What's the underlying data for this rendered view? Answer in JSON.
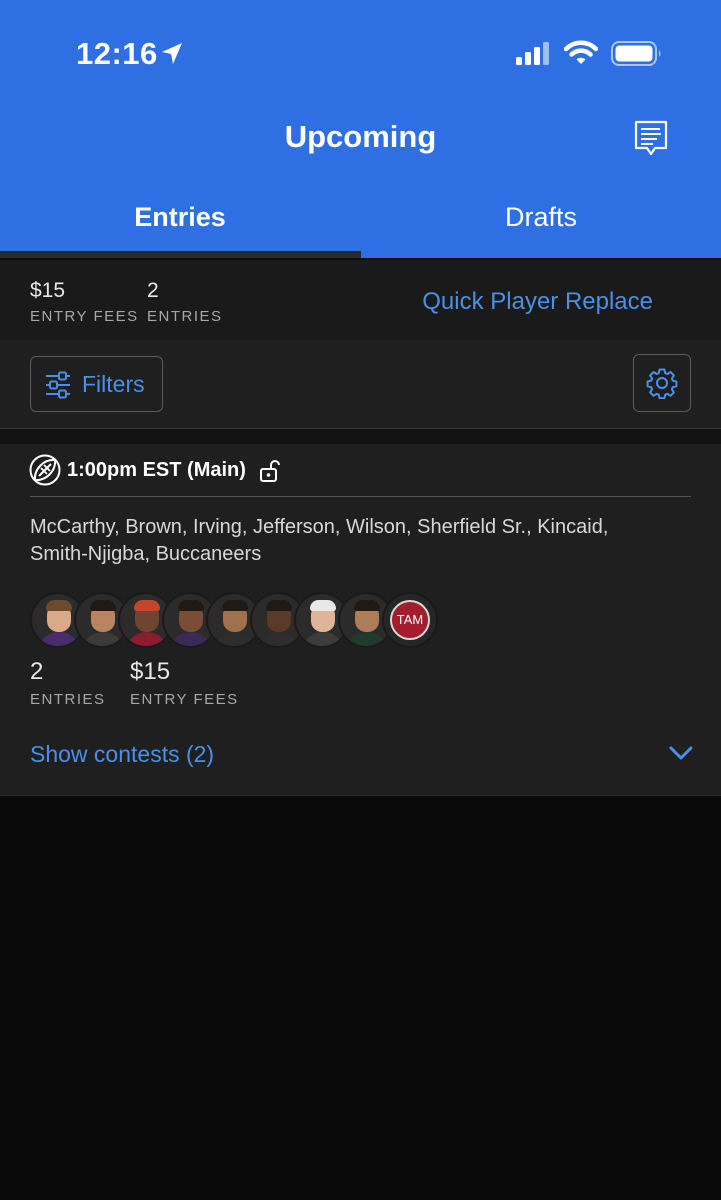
{
  "status_bar": {
    "time": "12:16"
  },
  "header": {
    "title": "Upcoming"
  },
  "tabs": [
    {
      "label": "Entries",
      "active": true
    },
    {
      "label": "Drafts",
      "active": false
    }
  ],
  "summary": {
    "entry_fees_value": "$15",
    "entry_fees_label": "ENTRY FEES",
    "entries_value": "2",
    "entries_label": "ENTRIES",
    "quick_replace": "Quick Player Replace"
  },
  "filters": {
    "label": "Filters"
  },
  "slate": {
    "title": "1:00pm EST (Main)",
    "players": "McCarthy, Brown, Irving, Jefferson, Wilson, Sherfield Sr., Kincaid, Smith-Njigba, Buccaneers",
    "team_badge": "TAM",
    "entries_value": "2",
    "entries_label": "ENTRIES",
    "entry_fees_value": "$15",
    "entry_fees_label": "ENTRY FEES",
    "show_contests": "Show contests (2)"
  },
  "icons": [
    "location-arrow-icon",
    "signal-icon",
    "wifi-icon",
    "battery-icon",
    "chat-icon",
    "sliders-icon",
    "gear-icon",
    "football-icon",
    "unlock-icon",
    "chevron-down-icon"
  ],
  "colors": {
    "header_blue": "#2f6fe4",
    "link_blue": "#4a90e8",
    "background": "#0a0a0a",
    "card": "#1f1f1f"
  }
}
